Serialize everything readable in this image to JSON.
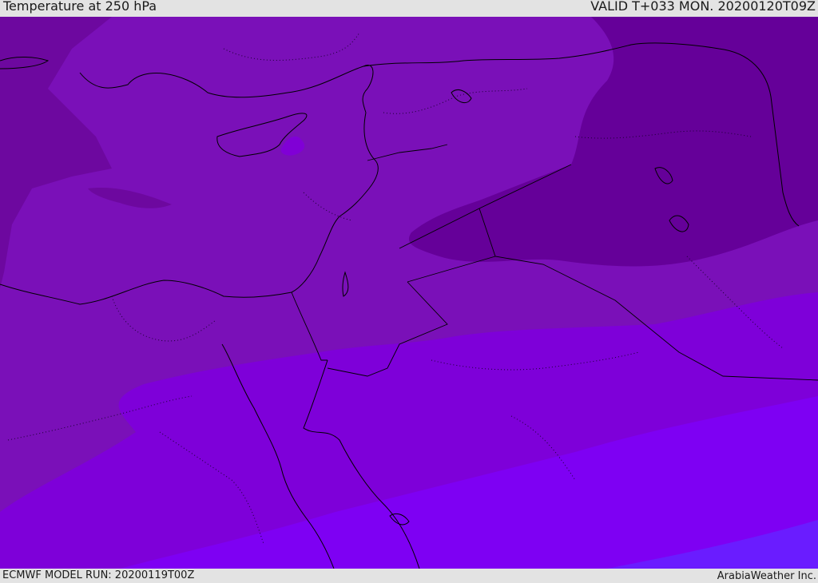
{
  "header": {
    "title": "Temperature at 250 hPa",
    "valid_time": "VALID T+033 MON. 20200120T09Z"
  },
  "footer": {
    "model_run": "ECMWF MODEL RUN: 20200119T00Z",
    "credit": "ArabiaWeather Inc."
  },
  "map": {
    "region": "Eastern Mediterranean and Middle East",
    "field": "temperature",
    "level": "250 hPa",
    "colors": {
      "coldest": "#650099",
      "cold": "#710aaa",
      "cool": "#7a10b8",
      "mid": "#8000d6",
      "warm": "#8000ee",
      "warmest": "#7a00ff",
      "blue_band": "#6a1cff",
      "coastline": "#000000"
    }
  }
}
